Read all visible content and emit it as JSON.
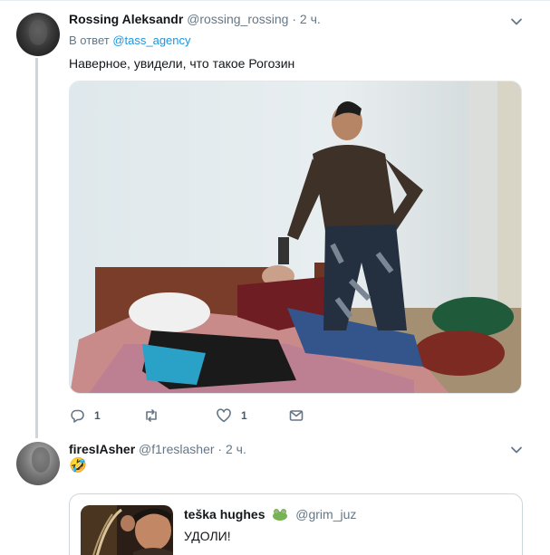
{
  "tweet1": {
    "author_name": "Rossing Aleksandr",
    "author_handle": "@rossing_rossing",
    "separator": "·",
    "time": "2 ч.",
    "reply_prefix": "В ответ",
    "reply_to": "@tass_agency",
    "text": "Наверное, увидели, что такое Рогозин",
    "reply_count": "1",
    "retweet_count": "",
    "like_count": "1"
  },
  "tweet2": {
    "author_name": "firesIAsher",
    "author_handle": "@f1reslasher",
    "separator": "·",
    "time": "2 ч.",
    "text": "🤣"
  },
  "quote": {
    "author_name": "teška hughes",
    "author_handle": "@grim_juz",
    "text": "УДОЛИ!"
  },
  "icons": {
    "chevron": "chevron-down-icon",
    "reply": "reply-icon",
    "retweet": "retweet-icon",
    "like": "heart-icon",
    "dm": "envelope-icon",
    "badge": "frog-emoji-icon"
  },
  "colors": {
    "text": "#14171a",
    "secondary": "#657786",
    "link": "#1b95e0",
    "border": "#ccd6dd"
  }
}
